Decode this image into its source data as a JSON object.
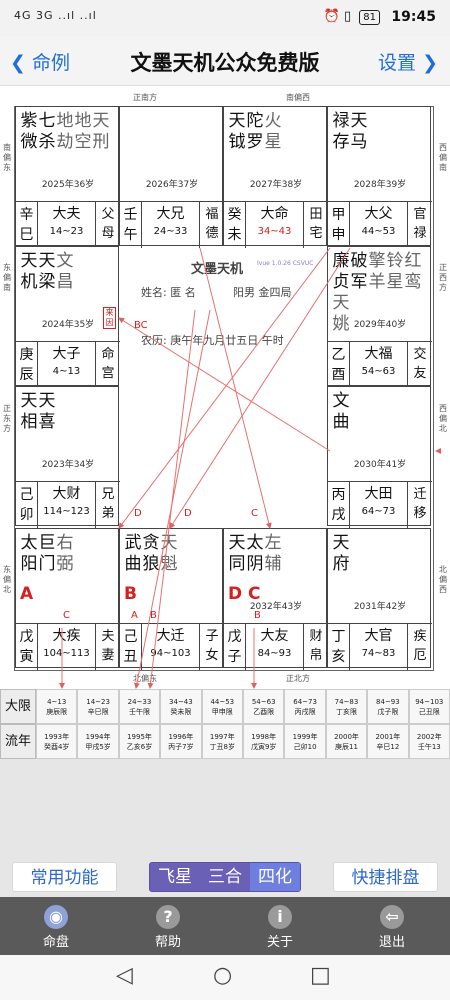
{
  "status": {
    "left": "4G  3G ..ıl ..ıl",
    "time": "19:45",
    "battery": "81"
  },
  "header": {
    "back_label": "命例",
    "title": "文墨天机公众免费版",
    "settings_label": "设置"
  },
  "directions": {
    "top_left": "正南方",
    "top_right": "南偏西",
    "bottom_left": "北偏东",
    "bottom_right": "正北方",
    "left_1": "南偏东",
    "left_2": "东偏南",
    "left_3": "正东方",
    "left_4": "东偏北",
    "right_1": "西偏南",
    "right_2": "正西方",
    "right_3": "西偏北",
    "right_4": "北偏西"
  },
  "palaces": [
    {
      "cols": [
        [
          "紫",
          "微"
        ],
        [
          "七",
          "杀"
        ],
        [
          "地",
          "劫"
        ],
        [
          "地",
          "空"
        ],
        [
          "天",
          "刑"
        ]
      ],
      "age": "2025年36岁",
      "gz": [
        "辛",
        "巳"
      ],
      "name": "大夫",
      "range": "14~23",
      "pr": [
        "父",
        "母"
      ]
    },
    {
      "cols": [],
      "age": "2026年37岁",
      "gz": [
        "壬",
        "午"
      ],
      "name": "大兄",
      "range": "24~33",
      "pr": [
        "福",
        "德"
      ]
    },
    {
      "cols": [
        [
          "天",
          "钺"
        ],
        [
          "陀",
          "罗"
        ],
        [
          "火",
          "星"
        ]
      ],
      "age": "2027年38岁",
      "gz": [
        "癸",
        "未"
      ],
      "name": "大命",
      "range": "34~43",
      "pr": [
        "田",
        "宅"
      ]
    },
    {
      "cols": [
        [
          "禄",
          "存"
        ],
        [
          "天",
          "马"
        ]
      ],
      "age": "2028年39岁",
      "gz": [
        "甲",
        "申"
      ],
      "name": "大父",
      "range": "44~53",
      "pr": [
        "官",
        "禄"
      ]
    },
    {
      "cols": [
        [
          "天",
          "机"
        ],
        [
          "天",
          "梁"
        ],
        [
          "文",
          "昌"
        ]
      ],
      "age": "2024年35岁",
      "gz": [
        "庚",
        "辰"
      ],
      "name": "大子",
      "range": "4~13",
      "pr": [
        "命",
        "宫"
      ]
    },
    {
      "cols": [
        [
          "廉",
          "贞"
        ],
        [
          "破",
          "军"
        ],
        [
          "擎",
          "羊"
        ],
        [
          "铃",
          "星"
        ],
        [
          "红",
          "鸾"
        ],
        [
          "天",
          "姚"
        ]
      ],
      "age": "2029年40岁",
      "gz": [
        "乙",
        "酉"
      ],
      "name": "大福",
      "range": "54~63",
      "pr": [
        "交",
        "友"
      ]
    },
    {
      "cols": [
        [
          "天",
          "相"
        ],
        [
          "天",
          "喜"
        ]
      ],
      "age": "2023年34岁",
      "gz": [
        "己",
        "卯"
      ],
      "name": "大财",
      "range": "114~123",
      "pr": [
        "兄",
        "弟"
      ]
    },
    {
      "cols": [
        [
          "文",
          "曲"
        ]
      ],
      "age": "2030年41岁",
      "gz": [
        "丙",
        "戌"
      ],
      "name": "大田",
      "range": "64~73",
      "pr": [
        "迁",
        "移"
      ]
    },
    {
      "cols": [
        [
          "太",
          "阳"
        ],
        [
          "巨",
          "门"
        ],
        [
          "右",
          "弼"
        ]
      ],
      "age": "",
      "gz": [
        "戊",
        "寅"
      ],
      "name": "大疾",
      "range": "104~113",
      "pr": [
        "夫",
        "妻"
      ]
    },
    {
      "cols": [
        [
          "武",
          "曲"
        ],
        [
          "贪",
          "狼"
        ],
        [
          "天",
          "魁"
        ]
      ],
      "age": "",
      "gz": [
        "己",
        "丑"
      ],
      "name": "大迁",
      "range": "94~103",
      "pr": [
        "子",
        "女"
      ]
    },
    {
      "cols": [
        [
          "天",
          "同"
        ],
        [
          "太",
          "阴"
        ],
        [
          "左",
          "辅"
        ]
      ],
      "age": "2032年43岁",
      "gz": [
        "戊",
        "子"
      ],
      "name": "大友",
      "range": "84~93",
      "pr": [
        "财",
        "帛"
      ]
    },
    {
      "cols": [
        [
          "天",
          "府"
        ]
      ],
      "age": "2031年42岁",
      "gz": [
        "丁",
        "亥"
      ],
      "name": "大官",
      "range": "74~83",
      "pr": [
        "疾",
        "厄"
      ]
    }
  ],
  "center": {
    "title": "文墨天机",
    "version": "Ivue 1.0.26 CSVUC",
    "name_line": "姓名: 匿 名",
    "bureau": "阳男 金四局",
    "lunar": "农历: 庚午年九月廿五日 午时",
    "laiyin": "来因"
  },
  "marks": {
    "A": "A",
    "B": "B",
    "C": "C",
    "D": "D",
    "BC": "BC",
    "DC": "D C"
  },
  "year_table": {
    "daxian_label": "大限",
    "liunian_label": "流年",
    "daxian": [
      [
        "4~13",
        "庚辰限"
      ],
      [
        "14~23",
        "辛巳限"
      ],
      [
        "24~33",
        "壬午限"
      ],
      [
        "34~43",
        "癸未限"
      ],
      [
        "44~53",
        "甲申限"
      ],
      [
        "54~63",
        "乙酉限"
      ],
      [
        "64~73",
        "丙戌限"
      ],
      [
        "74~83",
        "丁亥限"
      ],
      [
        "84~93",
        "戊子限"
      ],
      [
        "94~103",
        "己丑限"
      ]
    ],
    "liunian": [
      [
        "1993年",
        "癸酉4岁"
      ],
      [
        "1994年",
        "甲戌5岁"
      ],
      [
        "1995年",
        "乙亥6岁"
      ],
      [
        "1996年",
        "丙子7岁"
      ],
      [
        "1997年",
        "丁丑8岁"
      ],
      [
        "1998年",
        "戊寅9岁"
      ],
      [
        "1999年",
        "己卯10"
      ],
      [
        "2000年",
        "庚辰11"
      ],
      [
        "2001年",
        "辛巳12"
      ],
      [
        "2002年",
        "壬午13"
      ]
    ]
  },
  "buttons": {
    "common": "常用功能",
    "quick": "快捷排盘"
  },
  "segments": [
    "飞星",
    "三合",
    "四化"
  ],
  "tabs": [
    {
      "label": "命盘",
      "icon": "◉"
    },
    {
      "label": "帮助",
      "icon": "?"
    },
    {
      "label": "关于",
      "icon": "i"
    },
    {
      "label": "退出",
      "icon": "⇦"
    }
  ],
  "colors": {
    "accent": "#1e6fd9",
    "highlight": "#d62020",
    "segment": "#6a60b5"
  }
}
